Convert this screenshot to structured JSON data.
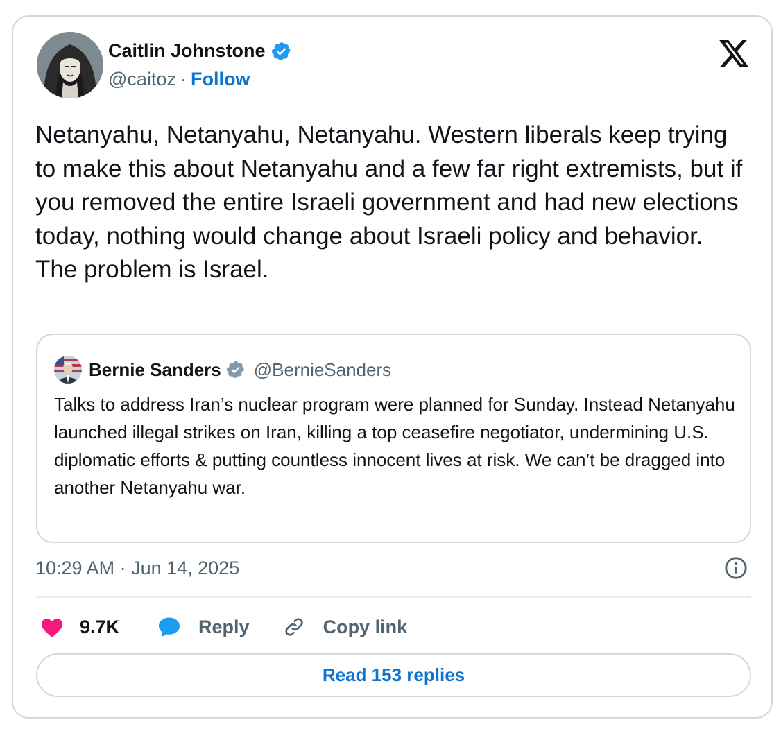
{
  "author": {
    "name": "Caitlin Johnstone",
    "handle": "@caitoz",
    "separator": "·",
    "follow_label": "Follow",
    "verified_color": "#1d9bf0"
  },
  "tweet": {
    "text": "Netanyahu, Netanyahu, Netanyahu. Western liberals keep trying to make this about Netanyahu and a few far right extremists, but if you removed the entire Israeli government and had new elections today, nothing would change about Israeli policy and behavior. The problem is Israel.",
    "timestamp": "10:29 AM · Jun 14, 2025"
  },
  "quote": {
    "name": "Bernie Sanders",
    "handle": "@BernieSanders",
    "verified_color": "#829aab",
    "text": "Talks to address Iran’s nuclear program were planned for Sunday. Instead Netanyahu launched illegal strikes on Iran, killing a top ceasefire negotiator, undermining U.S. diplomatic efforts & putting countless innocent lives at risk. We can’t be dragged into another Netanyahu war."
  },
  "actions": {
    "like_count": "9.7K",
    "reply_label": "Reply",
    "copy_link_label": "Copy link",
    "like_color": "#f91880",
    "reply_color": "#1d9bf0"
  },
  "footer": {
    "read_replies_label": "Read 153 replies"
  },
  "icons": {
    "brand": "x-logo-icon",
    "verified": "verified-badge-icon",
    "info": "info-icon",
    "like": "heart-icon",
    "reply": "speech-bubble-icon",
    "copy_link": "link-icon"
  }
}
